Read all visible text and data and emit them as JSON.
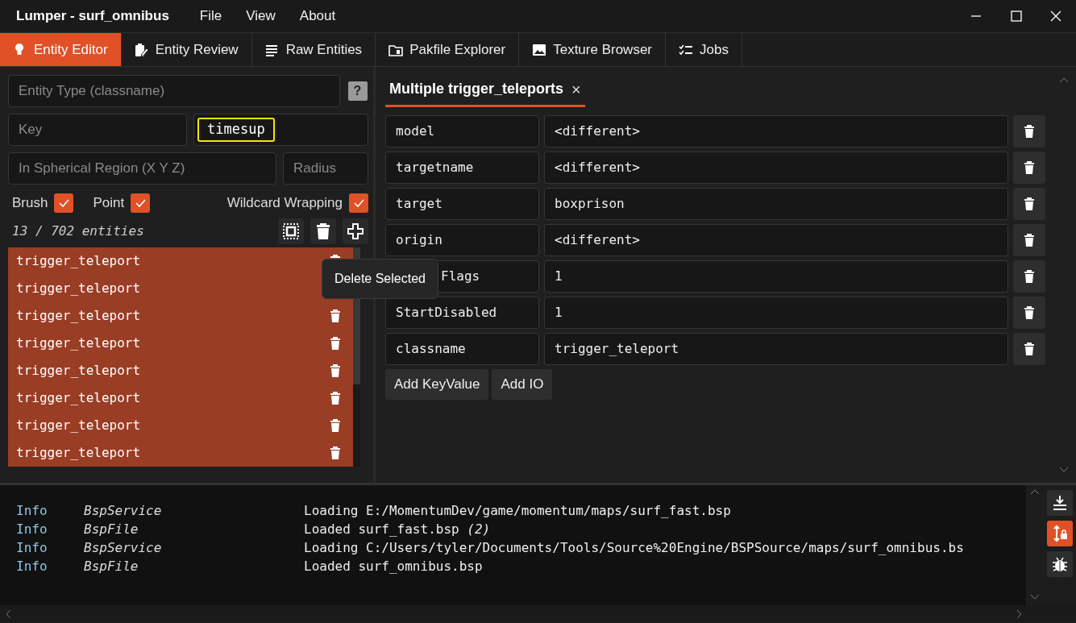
{
  "window": {
    "title": "Lumper - surf_omnibus",
    "menu": [
      "File",
      "View",
      "About"
    ]
  },
  "tabs": [
    {
      "label": "Entity Editor",
      "selected": true
    },
    {
      "label": "Entity Review",
      "selected": false
    },
    {
      "label": "Raw Entities",
      "selected": false
    },
    {
      "label": "Pakfile Explorer",
      "selected": false
    },
    {
      "label": "Texture Browser",
      "selected": false
    },
    {
      "label": "Jobs",
      "selected": false
    }
  ],
  "filters": {
    "classname": {
      "placeholder": "Entity Type (classname)"
    },
    "help": "?",
    "key": {
      "placeholder": "Key"
    },
    "value": {
      "value": "timesup",
      "highlighted": true
    },
    "region": {
      "placeholder": "In Spherical Region (X Y Z)"
    },
    "radius": {
      "placeholder": "Radius"
    },
    "checks": [
      {
        "label": "Brush",
        "checked": true
      },
      {
        "label": "Point",
        "checked": true
      },
      {
        "label": "Wildcard Wrapping",
        "checked": true
      }
    ]
  },
  "count": "13 / 702 entities",
  "tooltip": "Delete Selected",
  "entities": [
    {
      "name": "trigger_teleport",
      "selected": true
    },
    {
      "name": "trigger_teleport",
      "selected": true
    },
    {
      "name": "trigger_teleport",
      "selected": true
    },
    {
      "name": "trigger_teleport",
      "selected": true
    },
    {
      "name": "trigger_teleport",
      "selected": true
    },
    {
      "name": "trigger_teleport",
      "selected": true
    },
    {
      "name": "trigger_teleport",
      "selected": true
    },
    {
      "name": "trigger_teleport",
      "selected": true
    }
  ],
  "editor": {
    "tab": "Multiple trigger_teleports",
    "close": "×",
    "properties": [
      {
        "key": "model",
        "value": "<different>"
      },
      {
        "key": "targetname",
        "value": "<different>"
      },
      {
        "key": "target",
        "value": "boxprison"
      },
      {
        "key": "origin",
        "value": "<different>"
      },
      {
        "key": "Flags",
        "value": "1",
        "covered": true
      },
      {
        "key": "StartDisabled",
        "value": "1"
      },
      {
        "key": "classname",
        "value": "trigger_teleport"
      }
    ],
    "buttons": [
      "Add KeyValue",
      "Add IO"
    ]
  },
  "log": {
    "lines": [
      {
        "level": "Info",
        "source": "BspService",
        "message": "Loading E:/MomentumDev/game/momentum/maps/surf_fast.bsp"
      },
      {
        "level": "Info",
        "source": "BspFile",
        "message": "Loaded surf_fast.bsp *(2)*"
      },
      {
        "level": "Info",
        "source": "BspService",
        "message": "Loading C:/Users/tyler/Documents/Tools/Source%20Engine/BSPSource/maps/surf_omnibus.bs"
      },
      {
        "level": "Info",
        "source": "BspFile",
        "message": "Loaded surf_omnibus.bsp"
      }
    ],
    "autoscroll_locked": true
  }
}
